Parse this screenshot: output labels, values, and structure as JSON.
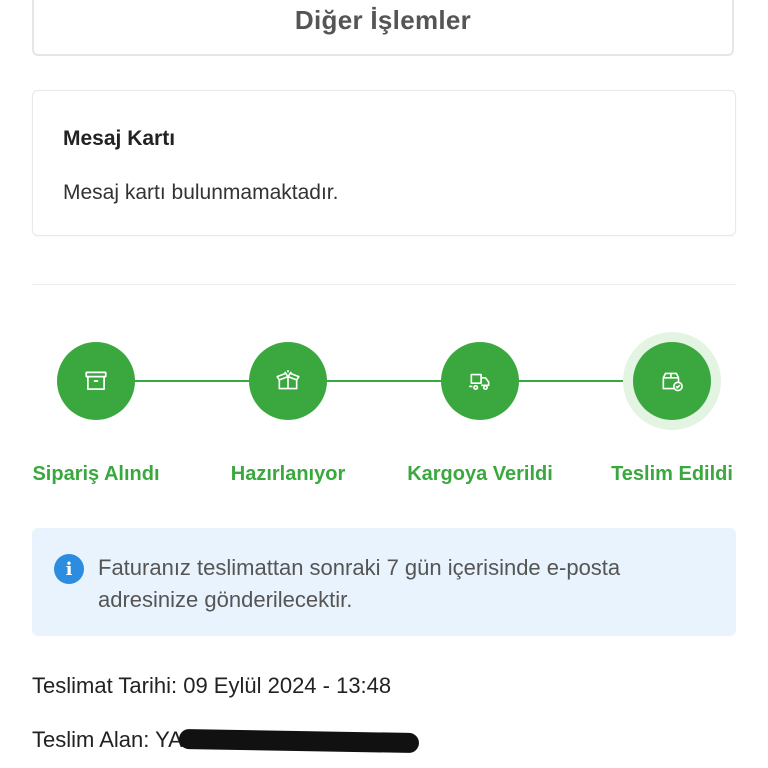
{
  "other_actions": {
    "label": "Diğer İşlemler"
  },
  "message_card": {
    "title": "Mesaj Kartı",
    "body": "Mesaj kartı bulunmamaktadır."
  },
  "order_tracking": {
    "steps": [
      {
        "label": "Sipariş Alındı",
        "icon": "archive-box-icon",
        "completed": true
      },
      {
        "label": "Hazırlanıyor",
        "icon": "open-package-icon",
        "completed": true
      },
      {
        "label": "Kargoya Verildi",
        "icon": "delivery-truck-icon",
        "completed": true
      },
      {
        "label": "Teslim Edildi",
        "icon": "package-check-icon",
        "completed": true,
        "current": true
      }
    ],
    "accent_color": "#3aa83f"
  },
  "invoice_notice": {
    "icon": "info-icon",
    "text": "Faturanız teslimattan sonraki 7 gün içerisinde e-posta adresinize gönderilecektir.",
    "background": "#e8f3fd"
  },
  "delivery": {
    "date_label": "Teslimat Tarihi:",
    "date_value": "09 Eylül 2024 - 13:48",
    "receiver_label": "Teslim Alan:",
    "receiver_value_prefix": "YA"
  }
}
